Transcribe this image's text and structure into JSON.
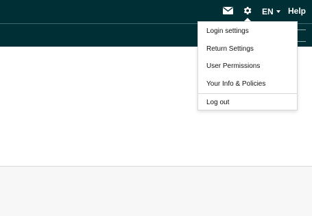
{
  "header": {
    "icons": {
      "mail": "mail-icon",
      "settings": "gear-icon"
    },
    "language": "EN",
    "help": "Help"
  },
  "settings_menu": {
    "items": [
      {
        "label": "Login settings"
      },
      {
        "label": "Return Settings"
      },
      {
        "label": "User Permissions"
      },
      {
        "label": "Your Info & Policies"
      }
    ],
    "logout": "Log out"
  },
  "colors": {
    "header_bg": "#002f36",
    "footer_bg": "#f7f7f7",
    "menu_border": "#d5d9d9"
  }
}
